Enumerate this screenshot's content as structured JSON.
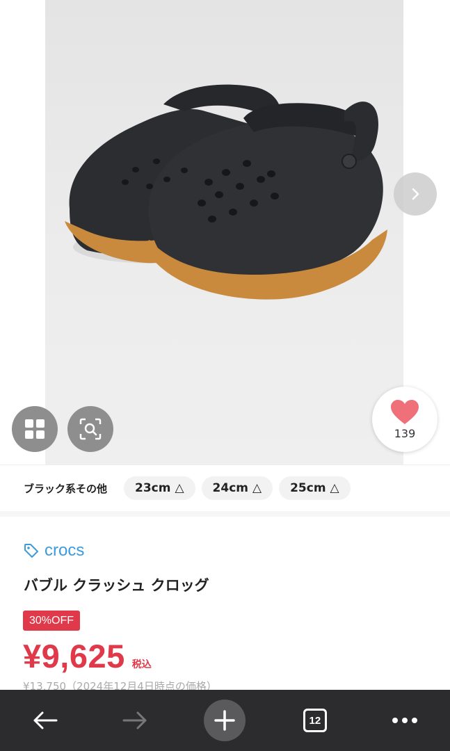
{
  "product_image": {
    "like_count": "139"
  },
  "variants": {
    "color_label": "ブラック系その他",
    "sizes": [
      {
        "label": "23cm",
        "stock_mark": "△"
      },
      {
        "label": "24cm",
        "stock_mark": "△"
      },
      {
        "label": "25cm",
        "stock_mark": "△"
      }
    ]
  },
  "product": {
    "brand": "crocs",
    "title": "バブル クラッシュ クロッグ",
    "discount_badge": "30%OFF",
    "price": "¥9,625",
    "tax_label": "税込",
    "original_price": "¥13,750（2024年12月4日時点の価格）"
  },
  "browser_toolbar": {
    "tab_count": "12"
  },
  "colors": {
    "accent_red": "#e03a4a",
    "brand_blue": "#3d9bdc",
    "heart_pink": "#f0707a",
    "toolbar_bg": "#2c2c2e"
  },
  "icons": [
    "grid-icon",
    "visual-search-icon",
    "chevron-right-icon",
    "heart-icon",
    "tag-icon",
    "back-arrow-icon",
    "forward-arrow-icon",
    "plus-icon",
    "tabs-icon",
    "more-icon"
  ]
}
